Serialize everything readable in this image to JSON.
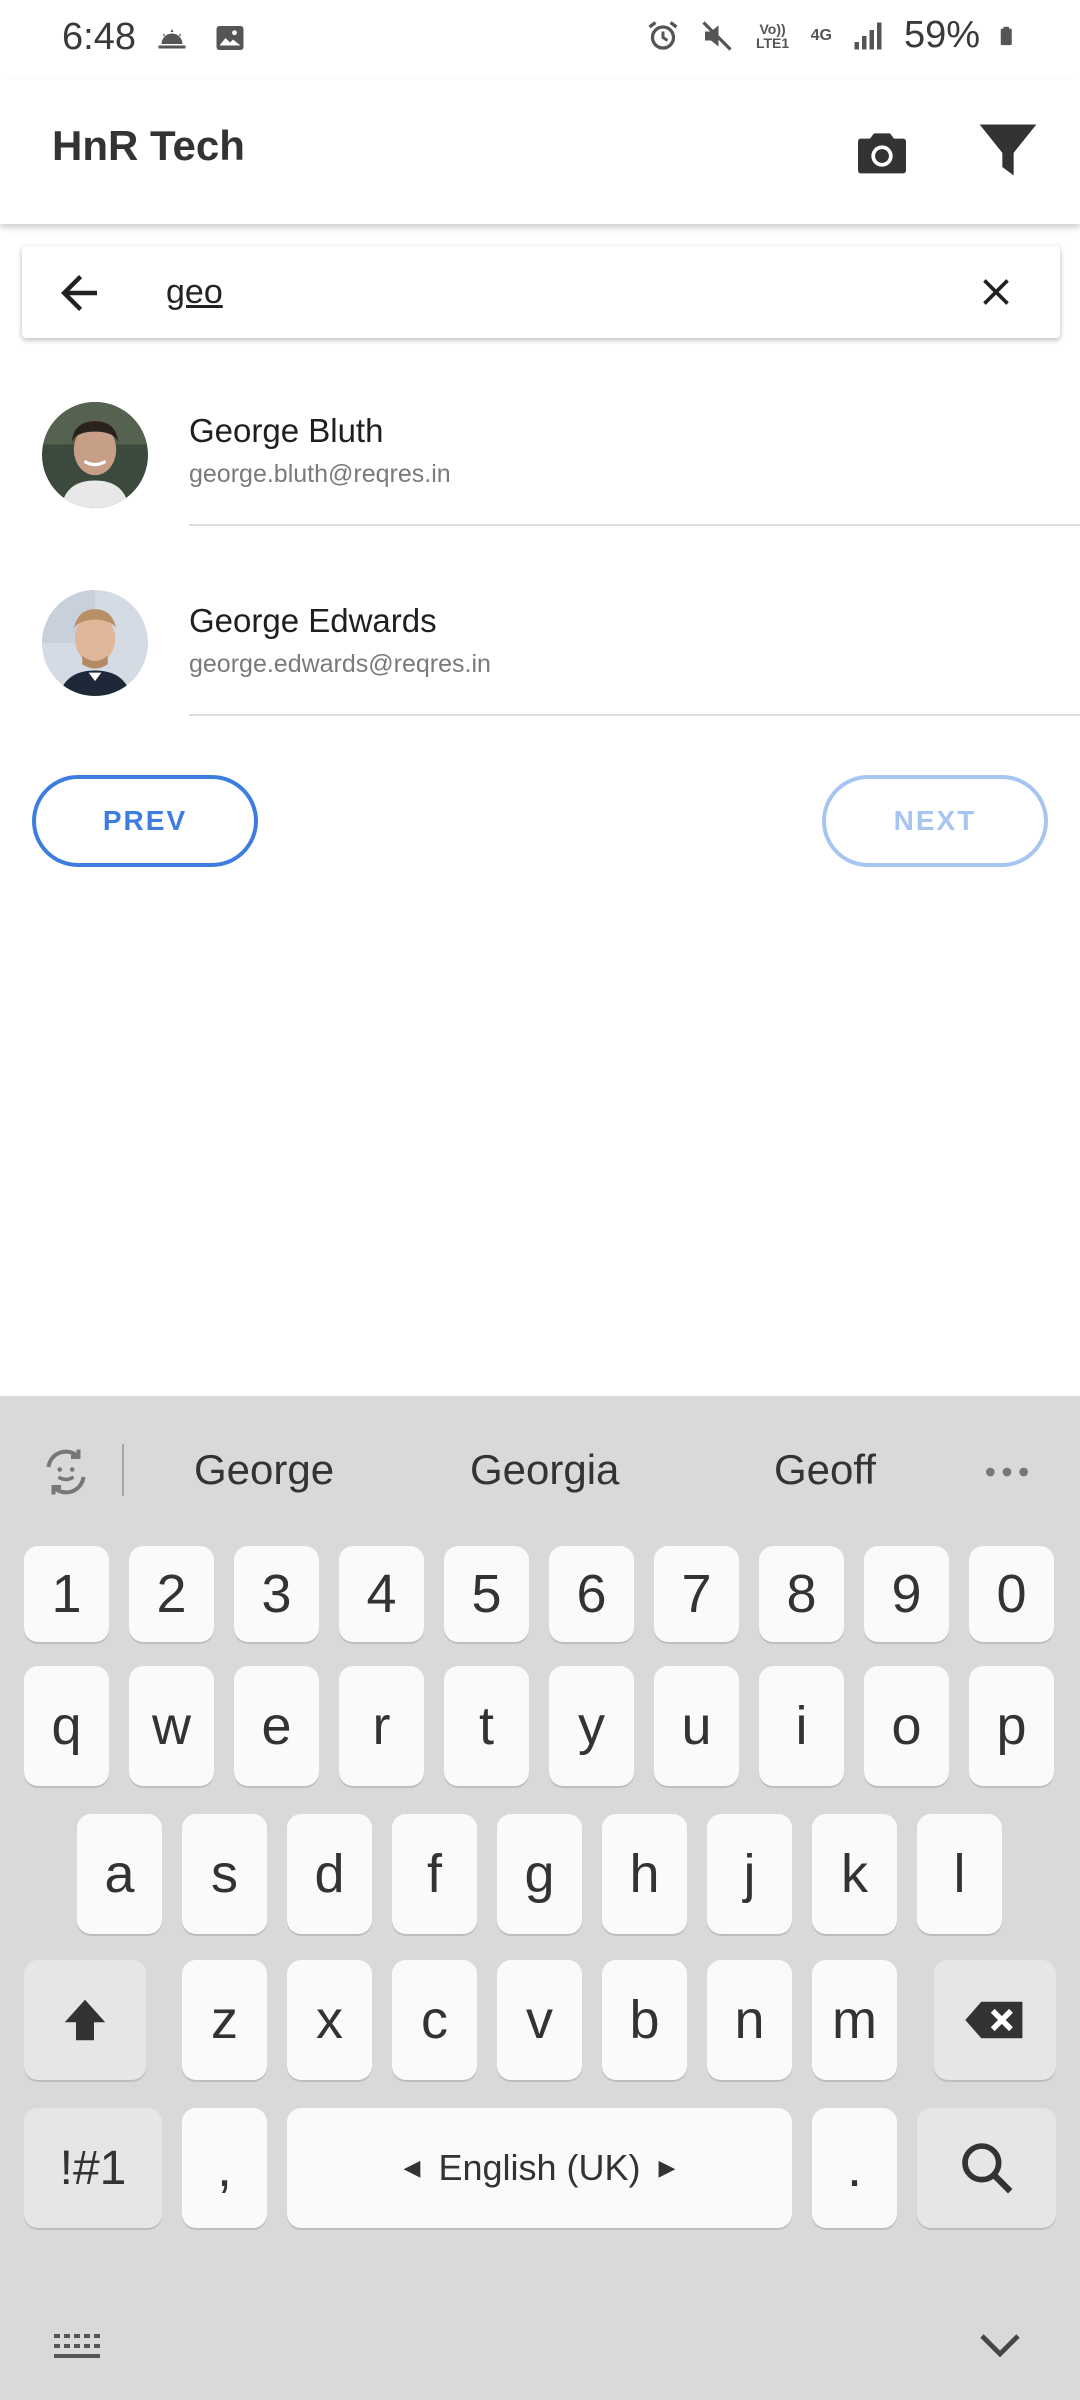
{
  "status_bar": {
    "time": "6:48",
    "battery": "59%",
    "icons": [
      "weather-icon",
      "image-icon",
      "alarm-icon",
      "mute-icon",
      "volte-icon",
      "4g-icon",
      "signal-icon",
      "battery-icon"
    ],
    "volte_label": "Vo)) LTE1",
    "network_label": "4G"
  },
  "app_bar": {
    "title": "HnR Tech"
  },
  "search": {
    "value": "geo"
  },
  "results": [
    {
      "name": "George Bluth",
      "email": "george.bluth@reqres.in"
    },
    {
      "name": "George Edwards",
      "email": "george.edwards@reqres.in"
    }
  ],
  "pagination": {
    "prev_label": "PREV",
    "next_label": "NEXT"
  },
  "keyboard": {
    "suggestions": [
      "George",
      "Georgia",
      "Geoff"
    ],
    "number_row": [
      "1",
      "2",
      "3",
      "4",
      "5",
      "6",
      "7",
      "8",
      "9",
      "0"
    ],
    "row1": [
      "q",
      "w",
      "e",
      "r",
      "t",
      "y",
      "u",
      "i",
      "o",
      "p"
    ],
    "row2": [
      "a",
      "s",
      "d",
      "f",
      "g",
      "h",
      "j",
      "k",
      "l"
    ],
    "row3": [
      "z",
      "x",
      "c",
      "v",
      "b",
      "n",
      "m"
    ],
    "symbols_label": "!#1",
    "comma_label": ",",
    "space_label": "English (UK)",
    "period_label": "."
  },
  "colors": {
    "accent": "#3d7de0",
    "accent_disabled": "#a7c5f1",
    "keyboard_bg": "#d9d9d9"
  }
}
